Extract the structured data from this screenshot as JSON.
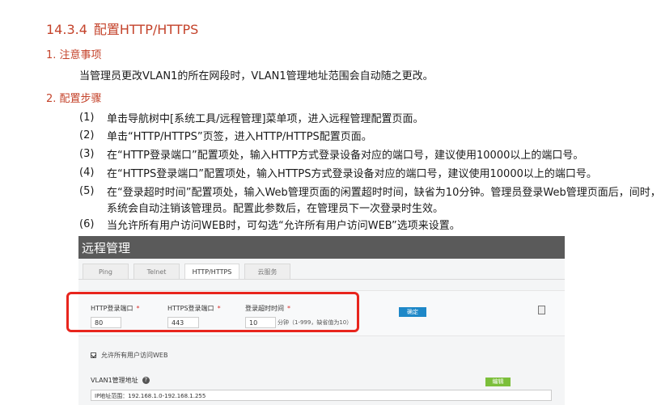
{
  "section": {
    "number": "14.3.4",
    "title": "配置HTTP/HTTPS"
  },
  "notes": {
    "heading": "1. 注意事项",
    "text": "当管理员更改VLAN1的所在网段时，VLAN1管理地址范围会自动随之更改。"
  },
  "steps": {
    "heading": "2. 配置步骤",
    "items": [
      {
        "n": "(1)",
        "text": "单击导航树中[系统工具/远程管理]菜单项，进入远程管理配置页面。"
      },
      {
        "n": "(2)",
        "text": "单击“HTTP/HTTPS”页签，进入HTTP/HTTPS配置页面。"
      },
      {
        "n": "(3)",
        "text": "在“HTTP登录端口”配置项处，输入HTTP方式登录设备对应的端口号，建议使用10000以上的端口号。"
      },
      {
        "n": "(4)",
        "text": "在“HTTPS登录端口”配置项处，输入HTTPS方式登录设备对应的端口号，建议使用10000以上的端口号。"
      },
      {
        "n": "(5)",
        "text": "在“登录超时时间”配置项处，输入Web管理页面的闲置超时时间，缺省为10分钟。管理员登录Web管理页面后，间时，系统会自动注销该管理员。配置此参数后，在管理员下一次登录时生效。"
      },
      {
        "n": "(6)",
        "text": "当允许所有用户访问WEB时，可勾选“允许所有用户访问WEB”选项来设置。"
      }
    ]
  },
  "screenshot": {
    "title": "远程管理",
    "tabs": [
      "Ping",
      "Telnet",
      "HTTP/HTTPS",
      "云服务"
    ],
    "active_tab": "HTTP/HTTPS",
    "required_mark": "*",
    "fields": {
      "http_port": {
        "label": "HTTP登录端口",
        "value": "80"
      },
      "https_port": {
        "label": "HTTPS登录端口",
        "value": "443"
      },
      "timeout": {
        "label": "登录超时时间",
        "value": "10",
        "note": "分钟（1-999，缺省值为10）"
      }
    },
    "ok_button": "确定",
    "checkbox_label": "允许所有用户访问WEB",
    "checkbox_checked": true,
    "vlan_label": "VLAN1管理地址",
    "help_icon": "?",
    "edit_button": "编辑",
    "vlan_range": "IP地址范围：192.168.1.0-192.168.1.255"
  },
  "colors": {
    "heading": "#c4432b",
    "highlight_box": "#e8251d",
    "primary_button": "#1e88c8",
    "edit_button": "#7cbf3b"
  }
}
